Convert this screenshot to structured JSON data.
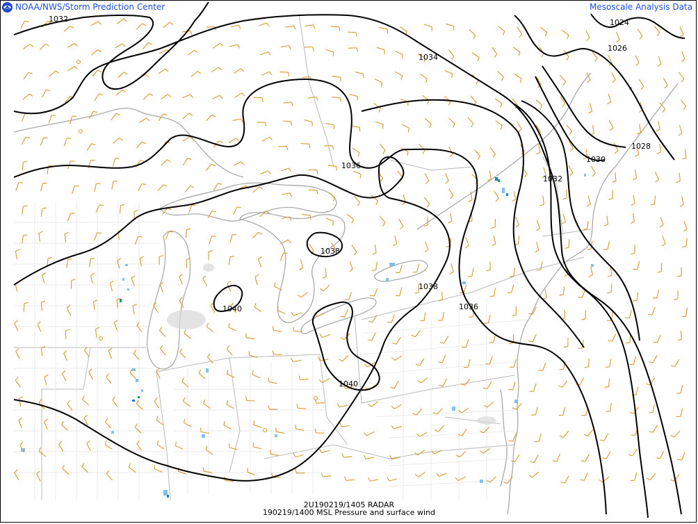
{
  "header": {
    "source": "NOAA/NWS/Storm Prediction Center",
    "product": "Mesoscale Analysis Data"
  },
  "footer": {
    "radar_line": "2U190219/1405 RADAR",
    "analysis_line": "190219/1400 MSL Pressure and surface wind"
  },
  "map": {
    "field": "MSL Pressure (mb)",
    "isobar_labels": [
      "1032",
      "1034",
      "1024",
      "1026",
      "1028",
      "1030",
      "1032",
      "1036",
      "1038",
      "1038",
      "1036",
      "1040",
      "1040"
    ],
    "colors": {
      "isobar": "#000000",
      "boundary": "#a8a8a8",
      "wind_barb": "#d49a2a",
      "radar_light": "#6fb6e6",
      "radar_medium": "#1f7fd0",
      "radar_heavy": "#14a04a",
      "title_text": "#1f4fd8"
    },
    "icons": [
      "noaa-logo-icon"
    ]
  }
}
